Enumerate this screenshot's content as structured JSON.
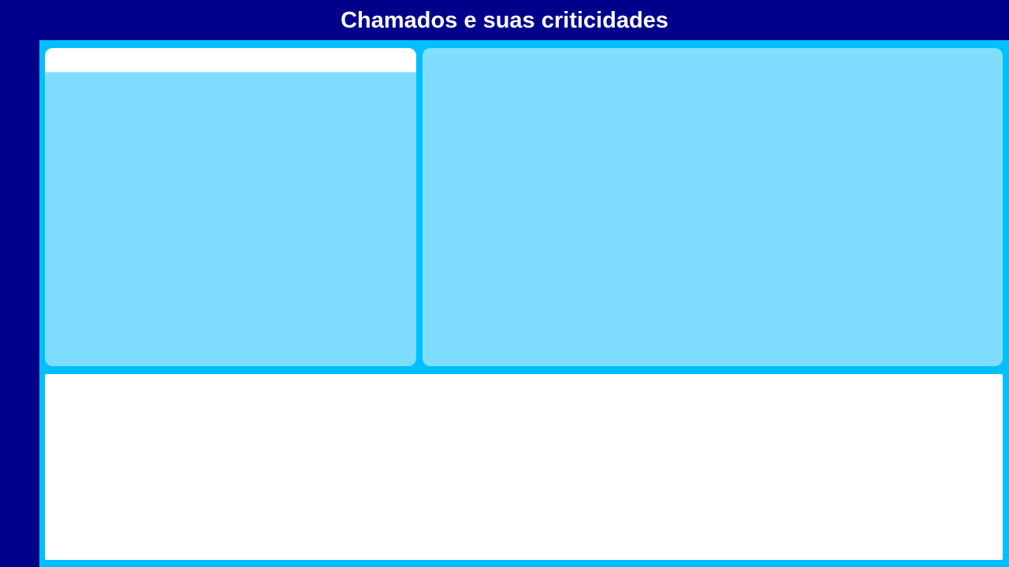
{
  "header": {
    "title": "Chamados e suas criticidades"
  },
  "colors": {
    "header_bg": "#00008B",
    "content_bg": "#00BFFF",
    "panel_bg": "#7FDEFF",
    "card_bg": "#FFFFFF",
    "title_text": "#FFFFFF"
  },
  "panels": {
    "left_header_text": "",
    "left_body_text": "",
    "right_body_text": "",
    "bottom_body_text": ""
  }
}
